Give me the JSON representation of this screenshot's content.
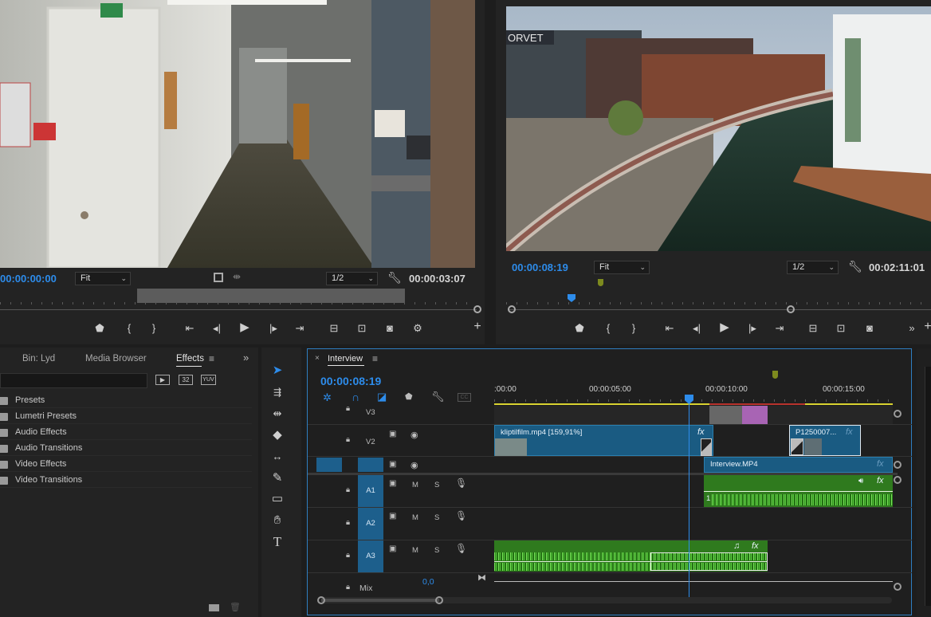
{
  "source_monitor": {
    "timecode_left": "00:00:00:00",
    "fit": "Fit",
    "resolution": "1/2",
    "timecode_right": "00:00:03:07"
  },
  "program_monitor": {
    "timecode_left": "00:00:08:19",
    "fit": "Fit",
    "resolution": "1/2",
    "timecode_right": "00:02:11:01"
  },
  "effects_panel": {
    "tabs": [
      "Bin: Lyd",
      "Media Browser",
      "Effects"
    ],
    "active_tab": "Effects",
    "preset_buttons": [
      "32",
      "YUV"
    ],
    "items": [
      "Presets",
      "Lumetri Presets",
      "Audio Effects",
      "Audio Transitions",
      "Video Effects",
      "Video Transitions"
    ]
  },
  "timeline": {
    "sequence_name": "Interview",
    "playhead_timecode": "00:00:08:19",
    "cc_label": "CC",
    "ruler_labels": [
      ":00:00",
      "00:00:05:00",
      "00:00:10:00",
      "00:00:15:00"
    ],
    "tracks": {
      "v3": "V3",
      "v2": "V2",
      "a1": "A1",
      "a2": "A2",
      "a3": "A3",
      "mix": "Mix",
      "mix_value": "0,0",
      "mute": "M",
      "solo": "S"
    },
    "clips": {
      "kliptilfilm": "kliptilfilm.mp4 [159,91%]",
      "p125": "P1250007...",
      "interview": "Interview.MP4",
      "a1_channel": "1",
      "fx": "fx"
    }
  },
  "colors": {
    "accent_blue": "#2d8ceb",
    "clip_blue": "#1a5b82",
    "audio_green": "#2f7a1e",
    "work_area_yellow": "#d8d230",
    "purple": "#a864b4"
  }
}
